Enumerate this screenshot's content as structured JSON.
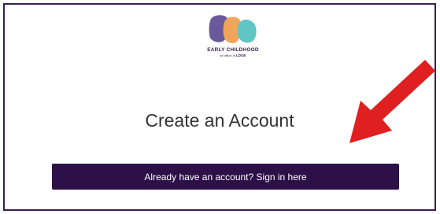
{
  "logo": {
    "wordmark": "EARLY CHILDHOOD",
    "sub_prefix": "an office of",
    "sub_brand": "LDOE"
  },
  "page": {
    "heading": "Create an Account"
  },
  "signin": {
    "label": "Already have an account? Sign in here"
  },
  "annotation": {
    "arrow_color": "#e02020"
  },
  "colors": {
    "brand_purple": "#2d1047",
    "border": "#3b1f55",
    "logo_purple": "#6a5a9b",
    "logo_orange": "#f0a55a",
    "logo_teal": "#5fc6c4"
  }
}
